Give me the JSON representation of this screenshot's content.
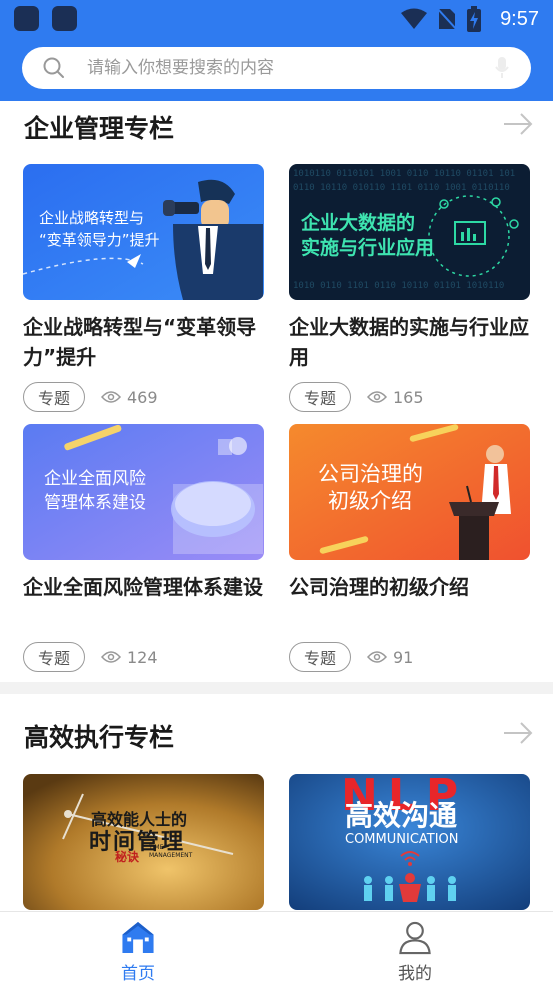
{
  "status_bar": {
    "time": "9:57"
  },
  "search": {
    "placeholder": "请输入你想要搜索的内容"
  },
  "sections": [
    {
      "title": "企业管理专栏",
      "cards": [
        {
          "title": "企业战略转型与“变革领导力”提升",
          "image_text_1": "企业战略转型与",
          "image_text_2": "“变革领导力”提升",
          "tag": "专题",
          "views": "469"
        },
        {
          "title": "企业大数据的实施与行业应用",
          "image_text_1": "企业大数据的",
          "image_text_2": "实施与行业应用",
          "tag": "专题",
          "views": "165"
        },
        {
          "title": "企业全面风险管理体系建设",
          "image_text_1": "企业全面风险",
          "image_text_2": "管理体系建设",
          "tag": "专题",
          "views": "124"
        },
        {
          "title": "公司治理的初级介绍",
          "image_text_1": "公司治理的",
          "image_text_2": "初级介绍",
          "tag": "专题",
          "views": "91"
        }
      ]
    },
    {
      "title": "高效执行专栏",
      "cards": [
        {
          "image_text_1": "高效能人士的",
          "image_text_2": "时间管理",
          "image_text_3": "秘诀",
          "image_text_4": "TIME",
          "image_text_5": "MANAGEMENT"
        },
        {
          "image_text_1": "NLP",
          "image_text_2": "高效沟通",
          "image_text_3": "COMMUNICATION"
        }
      ]
    }
  ],
  "nav": [
    {
      "label": "首页",
      "icon": "home-icon",
      "active": true
    },
    {
      "label": "我的",
      "icon": "user-icon",
      "active": false
    }
  ],
  "colors": {
    "primary": "#2f7bf0",
    "header_bg": "#2f7bf0",
    "nav_active": "#2f7bf0",
    "nav_inactive": "#555555"
  }
}
